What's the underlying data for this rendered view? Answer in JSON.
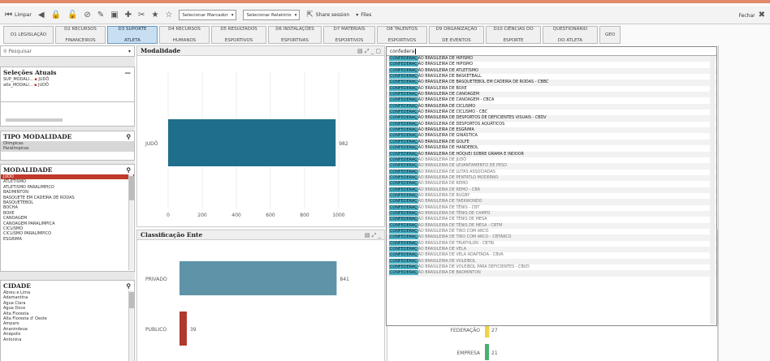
{
  "toolbar": {
    "clear_label": "Limpar",
    "select_marker": "Selecionar Marcador",
    "select_report": "Selecionar Relatório",
    "share_label": "Share session",
    "files_label": "Files",
    "close_label": "Fechar"
  },
  "tabs": [
    {
      "l1": "D1 LEGISLAÇÃO",
      "l2": ""
    },
    {
      "l1": "D2 RECURSOS",
      "l2": "FINANCEIROS"
    },
    {
      "l1": "D3 SUPORTE",
      "l2": "ATLETA"
    },
    {
      "l1": "D4 RECURSOS",
      "l2": "HUMANOS"
    },
    {
      "l1": "D5 RESULTADOS",
      "l2": "ESPORTIVOS"
    },
    {
      "l1": "D6 INSTALAÇÕES",
      "l2": "ESPORTIVAS"
    },
    {
      "l1": "D7 MATERIAIS",
      "l2": "ESPORTIVOS"
    },
    {
      "l1": "D8 TALENTOS",
      "l2": "ESPORTIVOS"
    },
    {
      "l1": "D9 ORGANIZAÇÃO",
      "l2": "DE EVENTOS"
    },
    {
      "l1": "D10 CIÊNCIAS DO",
      "l2": "ESPORTE"
    },
    {
      "l1": "QUESTIONÁRIO",
      "l2": "DO ATLETA"
    },
    {
      "l1": "GEO",
      "l2": ""
    }
  ],
  "search": {
    "placeholder": "Pesquisar"
  },
  "current_selections": {
    "title": "Seleções Atuais",
    "rows": [
      {
        "field": "SUP_MODALI...",
        "value": "JUDÔ"
      },
      {
        "field": "atle_MODALI...",
        "value": "JUDÔ"
      }
    ]
  },
  "tipo_modalidade": {
    "title": "TIPO MODALIDADE",
    "items": [
      "Olímpicas",
      "Paralímpicas"
    ]
  },
  "modalidade": {
    "title": "MODALIDADE",
    "items": [
      "JUDÔ",
      "ATLETISMO",
      "ATLETISMO PARALÍMPICO",
      "BADMINTON",
      "BASQUETE EM CADEIRA DE RODAS",
      "BASQUETEBOL",
      "BOCHA",
      "BOXE",
      "CANOAGEM",
      "CANOAGEM PARALÍMPICA",
      "CICLISMO",
      "CICLISMO PARALÍMPICO",
      "ESGRIMA"
    ]
  },
  "cidade": {
    "title": "CIDADE",
    "items": [
      "Abreu e Lima",
      "Adamantina",
      "Água Clara",
      "Água Doce",
      "Alta Floresta",
      "Alta Floresta d' Oeste",
      "Amparo",
      "Ananindeua",
      "Anápolis",
      "Antonina"
    ]
  },
  "chart_data": [
    {
      "type": "bar",
      "title": "Modalidade",
      "categories": [
        "JUDÔ"
      ],
      "values": [
        982
      ],
      "xlim": [
        0,
        1000
      ],
      "ticks": [
        "0",
        "200",
        "400",
        "600",
        "800",
        "1000"
      ]
    },
    {
      "type": "bar",
      "title": "Classificação Ente",
      "categories": [
        "PRIVADO",
        "PUBLICO"
      ],
      "values": [
        841,
        39
      ]
    },
    {
      "type": "bar",
      "title": "",
      "categories": [
        "FEDERAÇÃO",
        "EMPRESA"
      ],
      "values": [
        27,
        21
      ]
    }
  ],
  "dropdown": {
    "query": "confedera",
    "highlight": "CONFEDERAÇ",
    "items": [
      "ÃO BRASILEIRA DE HIPISMO",
      "ÃO BRASILEIRA DE HIPISMO",
      "ÃO BRASILEIRA DE ATLETISMO",
      "ÃO BRASILEIRA DE BASKETBALL",
      "ÃO BRASILEIRA DE BASQUETEBOL EM CADEIRA DE RODAS - CBBC",
      "ÃO BRASILEIRA DE BOXE",
      "ÃO BRASILEIRA DE CANOAGEM",
      "ÃO BRASILEIRA DE CANOAGEM - CBCA",
      "ÃO BRASILEIRA DE CICLISMO",
      "ÃO BRASILEIRA DE CICLISMO - CBC",
      "ÃO BRASILEIRA DE DESPORTOS DE DEFICIENTES VISUAIS - CBDV",
      "ÃO BRASILEIRA DE DESPORTOS AQUÁTICOS",
      "ÃO BRASILEIRA DE ESGRIMA",
      "ÃO BRASILEIRA DE GINÁSTICA",
      "ÃO BRASILEIRA DE GOLFE",
      "ÃO BRASILEIRA DE HANDEBOL",
      "ÃO BRASILEIRA DE HÓQUEI SOBRE GRAMA E INDOOR",
      "ÃO BRASILEIRA DE JUDÔ",
      "ÃO BRASILEIRA DE LEVANTAMENTO DE PESO",
      "ÃO BRASILEIRA DE LUTAS ASSOCIADAS",
      "ÃO BRASILEIRA DE PENTATLO MODERNO",
      "ÃO BRASILEIRA DE REMO",
      "ÃO BRASILEIRA DE REMO - CBR",
      "ÃO BRASILEIRA DE RUGBY",
      "ÃO BRASILEIRA DE TAEKWONDO",
      "ÃO BRASILEIRA DE TÊNIS - CBT",
      "ÃO BRASILEIRA DE TÊNIS DE CAMPO",
      "ÃO BRASILEIRA DE TÊNIS DE MESA",
      "ÃO BRASILEIRA DE TÊNIS DE MESA - CBTM",
      "ÃO BRASILEIRA DE TIRO COM ARCO",
      "ÃO BRASILEIRA DE TIRO COM ARCO - CBTARCO",
      "ÃO BRASILEIRA DE TRIATHLON - CBTRI",
      "ÃO BRASILEIRA DE VELA",
      "ÃO BRASILEIRA DE VELA ADAPTADA - CBVA",
      "ÃO BRASILEIRA DE VOLEIBOL",
      "ÃO BRASILEIRA DE VOLEIBOL PARA DEFICIENTES - CBVD",
      "ÃO BRASILEIRA DE BADMINTON"
    ]
  },
  "colors": {
    "accent": "#1f6e8c",
    "selected": "#c0392b",
    "highlight": "#4ab2c4",
    "yellow": "#f1d348",
    "green": "#4caf6f"
  }
}
